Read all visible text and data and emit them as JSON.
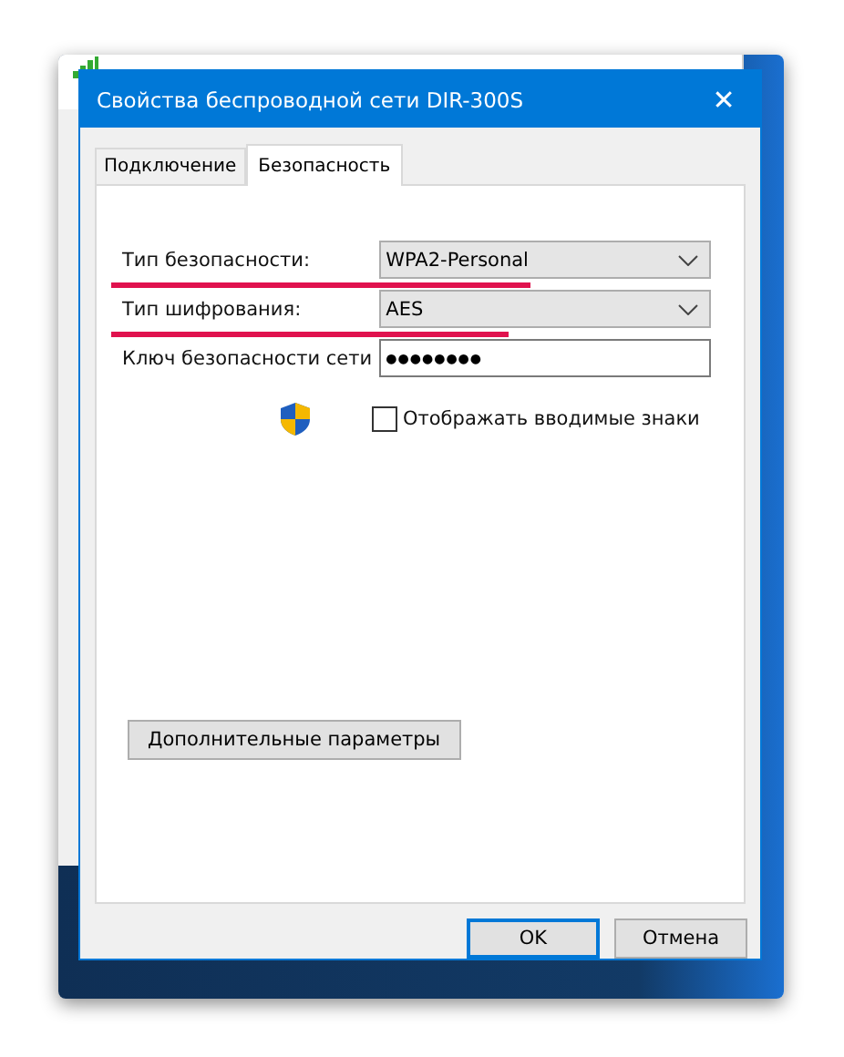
{
  "window": {
    "title": "Свойства беспроводной сети DIR-300S",
    "close": "✕"
  },
  "tabs": [
    {
      "label": "Подключение",
      "selected": false
    },
    {
      "label": "Безопасность",
      "selected": true
    }
  ],
  "fields": [
    {
      "kind": "select",
      "label": "Тип безопасности:",
      "value": "WPA2-Personal",
      "underlined": true
    },
    {
      "kind": "select",
      "label": "Тип шифрования:",
      "value": "AES",
      "underlined": true
    },
    {
      "kind": "password",
      "label": "Ключ безопасности сети",
      "value": "●●●●●●●●"
    }
  ],
  "show_characters": {
    "label": "Отображать вводимые знаки",
    "checked": false
  },
  "advanced_button": "Дополнительные параметры",
  "buttons": [
    {
      "label": "OK",
      "default": true
    },
    {
      "label": "Отмена",
      "default": false
    }
  ]
}
